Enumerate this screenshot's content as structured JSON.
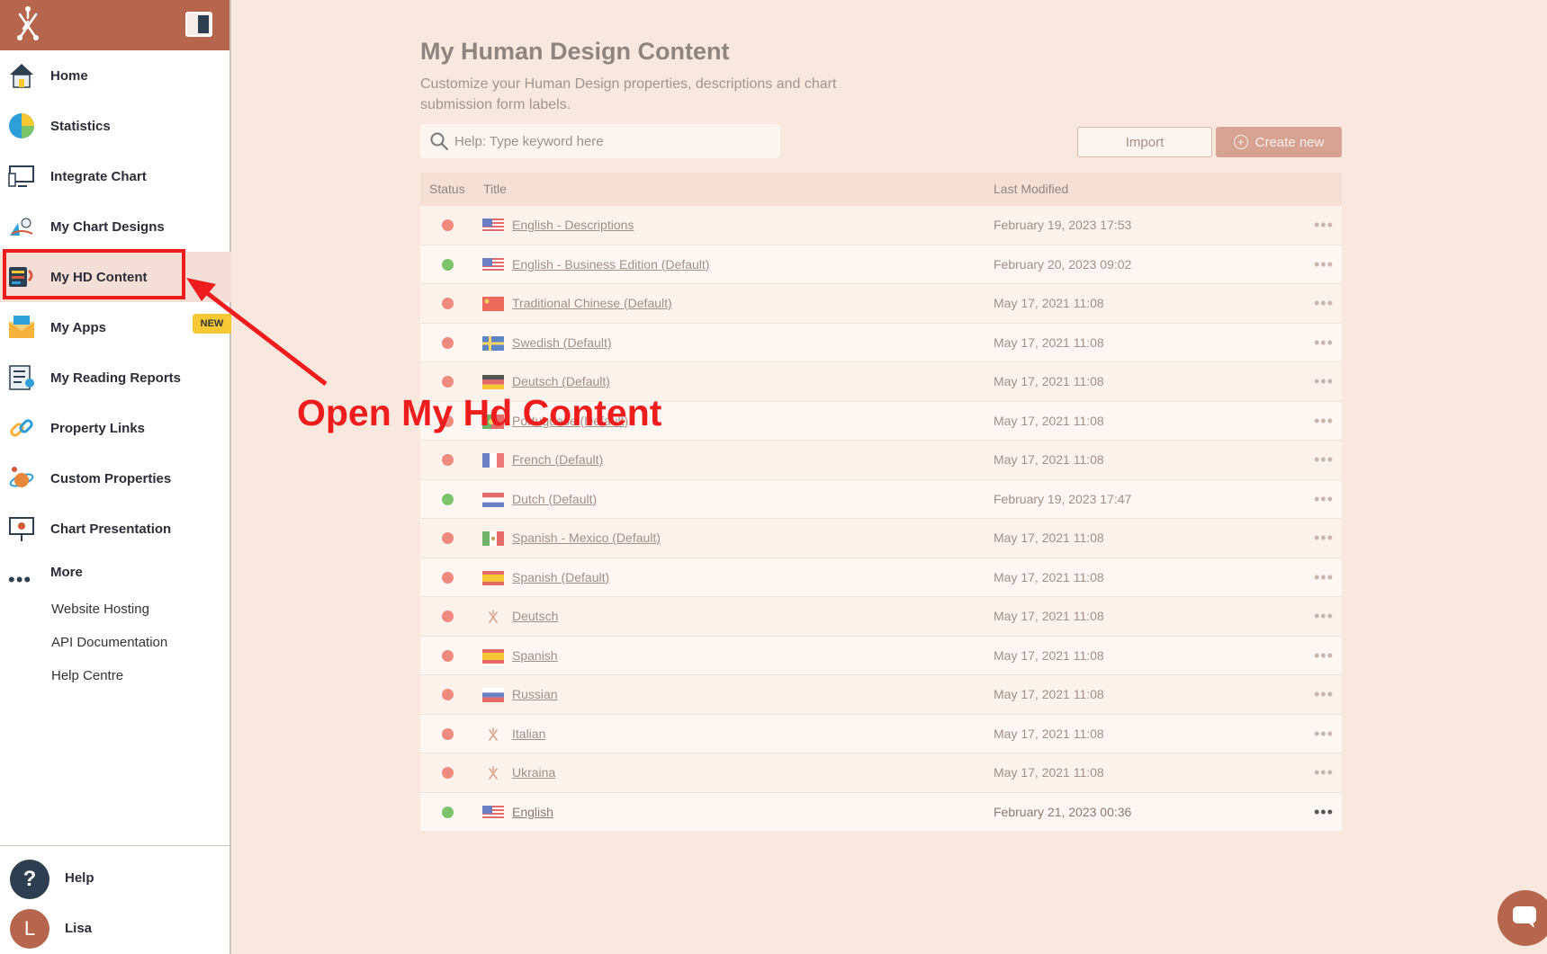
{
  "sidebar": {
    "items": [
      {
        "label": "Home",
        "icon": "home-icon"
      },
      {
        "label": "Statistics",
        "icon": "pie-chart-icon"
      },
      {
        "label": "Integrate Chart",
        "icon": "monitor-icon"
      },
      {
        "label": "My Chart Designs",
        "icon": "design-icon"
      },
      {
        "label": "My HD Content",
        "icon": "content-icon"
      },
      {
        "label": "My Apps",
        "icon": "apps-icon"
      },
      {
        "label": "My Reading Reports",
        "icon": "report-icon"
      },
      {
        "label": "Property Links",
        "icon": "link-icon"
      },
      {
        "label": "Custom Properties",
        "icon": "custom-properties-icon"
      },
      {
        "label": "Chart Presentation",
        "icon": "presentation-icon"
      }
    ],
    "new_badge": "NEW",
    "more_label": "More",
    "more_dots": "•••",
    "sub_links": [
      "Website Hosting",
      "API Documentation",
      "Help Centre"
    ],
    "help_label": "Help",
    "help_glyph": "?",
    "user_name": "Lisa",
    "user_initial": "L"
  },
  "annotation": {
    "text": "Open My Hd Content",
    "color": "#ee1d1d"
  },
  "main": {
    "title": "My Human Design Content",
    "subtitle": "Customize your Human Design properties, descriptions and chart submission form labels.",
    "search_placeholder": "Help: Type keyword here",
    "import_label": "Import",
    "create_label": "Create new",
    "create_icon": "+",
    "columns": {
      "status": "Status",
      "title": "Title",
      "last_modified": "Last Modified"
    },
    "row_menu": "•••",
    "rows": [
      {
        "status": "red",
        "flag": "us",
        "title": "English - Descriptions",
        "modified": "February 19, 2023 17:53"
      },
      {
        "status": "green",
        "flag": "us",
        "title": "English - Business Edition (Default)",
        "modified": "February 20, 2023 09:02"
      },
      {
        "status": "red",
        "flag": "cn",
        "title": "Traditional Chinese (Default)",
        "modified": "May 17, 2021 11:08"
      },
      {
        "status": "red",
        "flag": "se",
        "title": "Swedish (Default)",
        "modified": "May 17, 2021 11:08"
      },
      {
        "status": "red",
        "flag": "de",
        "title": "Deutsch (Default)",
        "modified": "May 17, 2021 11:08"
      },
      {
        "status": "red",
        "flag": "pt",
        "title": "Portuguese (Default)",
        "modified": "May 17, 2021 11:08"
      },
      {
        "status": "red",
        "flag": "fr",
        "title": "French (Default)",
        "modified": "May 17, 2021 11:08"
      },
      {
        "status": "green",
        "flag": "nl",
        "title": "Dutch (Default)",
        "modified": "February 19, 2023 17:47"
      },
      {
        "status": "red",
        "flag": "mx",
        "title": "Spanish - Mexico (Default)",
        "modified": "May 17, 2021 11:08"
      },
      {
        "status": "red",
        "flag": "es",
        "title": "Spanish (Default)",
        "modified": "May 17, 2021 11:08"
      },
      {
        "status": "red",
        "flag": "logo",
        "title": "Deutsch",
        "modified": "May 17, 2021 11:08"
      },
      {
        "status": "red",
        "flag": "es",
        "title": "Spanish",
        "modified": "May 17, 2021 11:08"
      },
      {
        "status": "red",
        "flag": "ru",
        "title": "Russian",
        "modified": "May 17, 2021 11:08"
      },
      {
        "status": "red",
        "flag": "logo",
        "title": "Italian",
        "modified": "May 17, 2021 11:08"
      },
      {
        "status": "red",
        "flag": "logo",
        "title": "Ukraina",
        "modified": "May 17, 2021 11:08"
      },
      {
        "status": "green",
        "flag": "us",
        "title": "English",
        "modified": "February 21, 2023 00:36"
      }
    ]
  },
  "colors": {
    "brand": "#b7664e",
    "status_red": "#ee8a7e",
    "status_green": "#7cc46a",
    "accent_button": "#d6a392",
    "page_bg": "#f8e8de"
  }
}
